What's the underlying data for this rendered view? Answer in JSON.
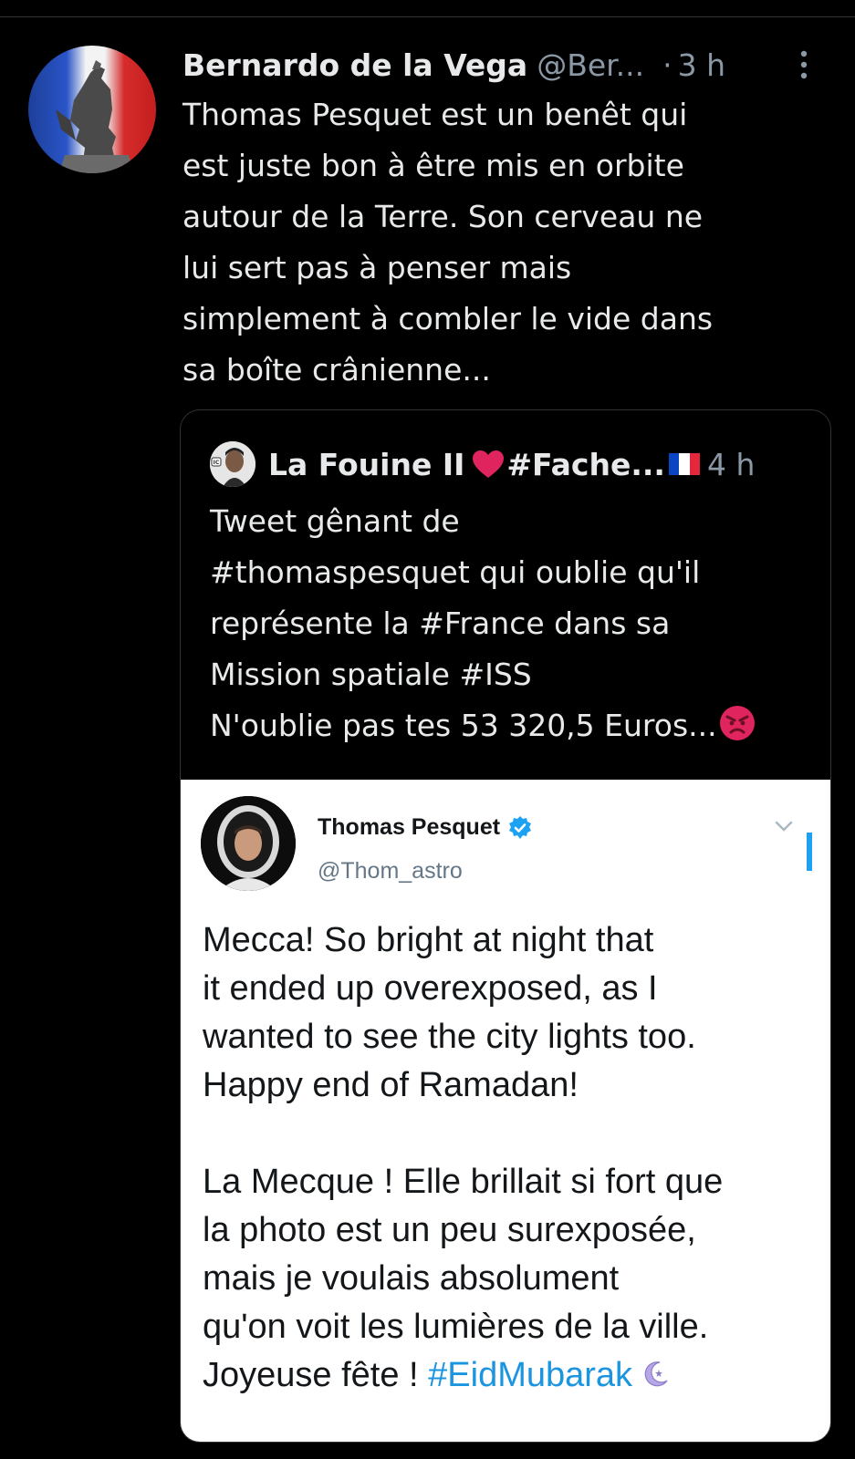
{
  "tweet": {
    "author_name": "Bernardo de la Vega",
    "author_handle": "@Ber...",
    "separator": "·",
    "time": "3 h",
    "text_lines": [
      "Thomas Pesquet est un benêt qui",
      "est juste bon à être mis en orbite",
      "autour de la Terre. Son cerveau ne",
      "lui sert pas à penser mais",
      "simplement à combler le vide dans",
      "sa boîte crânienne..."
    ]
  },
  "quoted": {
    "author_name": "La Fouine II",
    "name_suffix": "#Fache...",
    "time": "4 h",
    "text_lines": [
      "Tweet gênant de",
      "#thomaspesquet qui oublie qu'il",
      "représente la #France dans sa",
      "Mission spatiale #ISS",
      "N'oublie pas tes 53 320,5 Euros..."
    ],
    "embedded": {
      "author_name": "Thomas Pesquet",
      "author_handle": "@Thom_astro",
      "text_lines": [
        "Mecca! So bright at night that",
        "it ended up overexposed, as I",
        "wanted to see the city lights too.",
        "Happy end of Ramadan!",
        "",
        "La Mecque ! Elle brillait si fort que",
        "la photo est un peu surexposée,",
        "mais je voulais absolument",
        "qu'on voit les lumières de la ville."
      ],
      "last_line_text": "Joyeuse fête ! ",
      "hashtag": "#EidMubarak"
    }
  },
  "colors": {
    "background": "#000000",
    "primary_text": "#e7e9ea",
    "secondary_text": "#8b98a5",
    "link_blue": "#1b95e0",
    "verified_blue": "#1da1f2",
    "heart_red": "#e0245e"
  },
  "icons": {
    "more": "more-vertical-icon",
    "heart": "red-heart-icon",
    "flag": "france-flag-icon",
    "angry": "angry-face-icon",
    "verified": "verified-badge-icon",
    "chevron": "chevron-down-icon",
    "moon": "crescent-moon-icon"
  }
}
